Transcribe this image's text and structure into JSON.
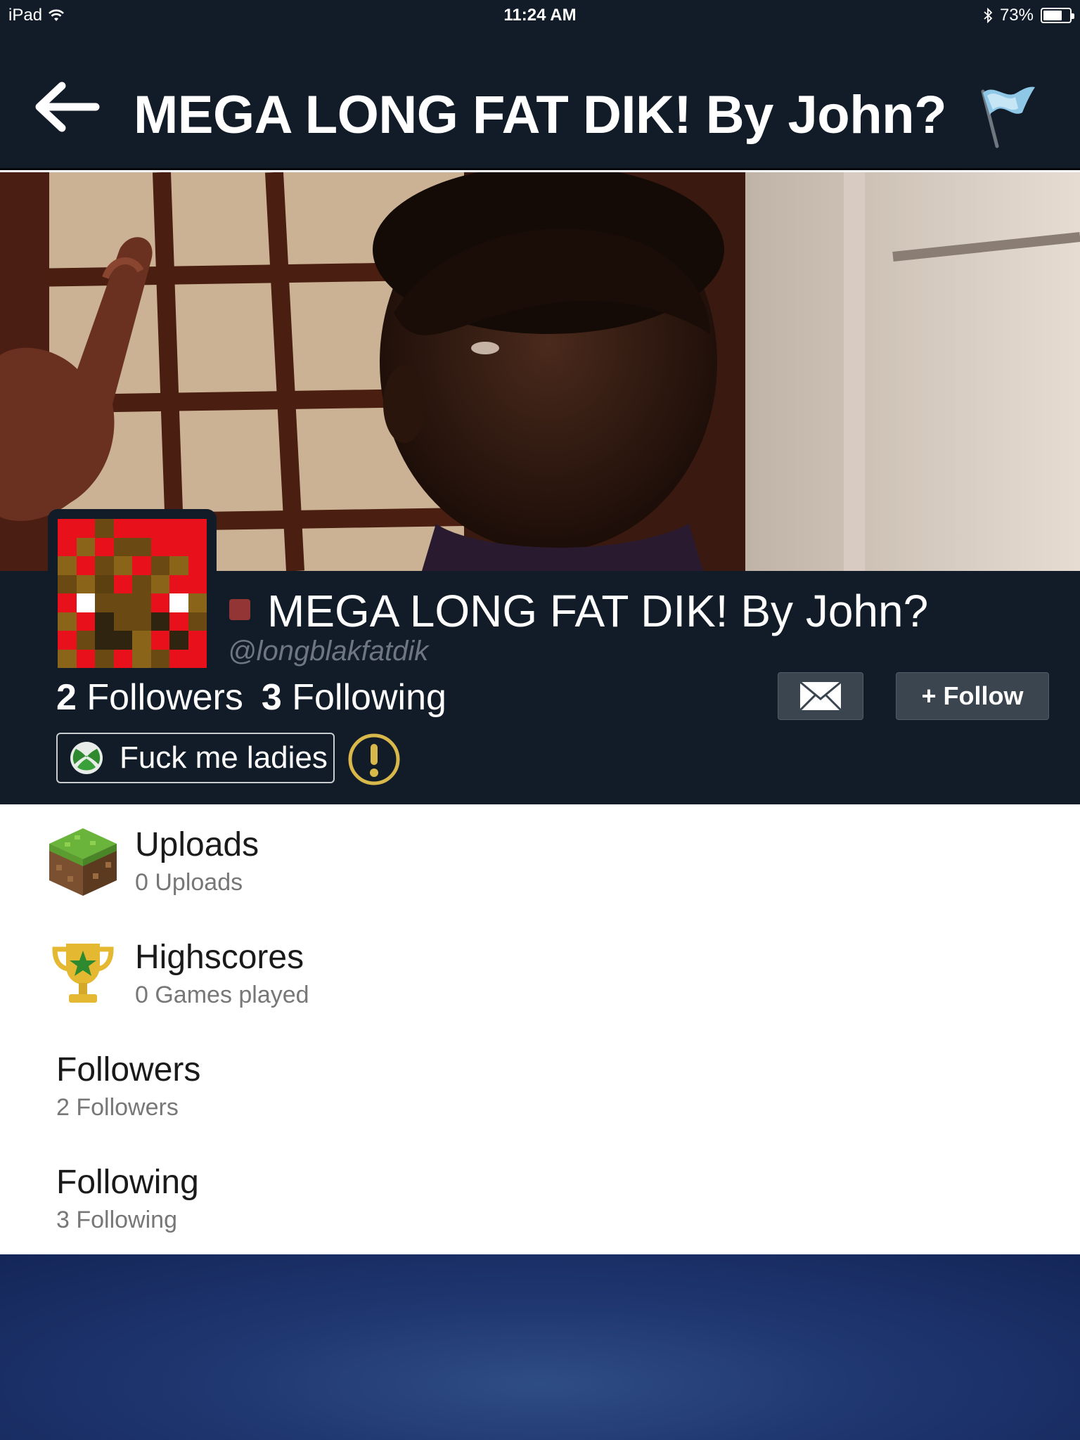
{
  "status_bar": {
    "device": "iPad",
    "time": "11:24 AM",
    "battery": "73%",
    "battery_level": 0.73
  },
  "nav": {
    "title": "MEGA LONG FAT DIK! By John?",
    "back_icon": "back-arrow-icon",
    "flag_icon": "flag-icon"
  },
  "profile": {
    "display_name": "MEGA LONG FAT DIK! By John?",
    "handle": "@longblakfatdik",
    "followers_count": "2",
    "followers_label": "Followers",
    "following_count": "3",
    "following_label": "Following",
    "follow_button": "+ Follow",
    "gamertag": "Fuck me ladies",
    "status_color": "#943535"
  },
  "list": {
    "uploads": {
      "title": "Uploads",
      "subtitle": "0 Uploads"
    },
    "highscores": {
      "title": "Highscores",
      "subtitle": "0 Games played"
    },
    "followers": {
      "title": "Followers",
      "subtitle": "2 Followers"
    },
    "following": {
      "title": "Following",
      "subtitle": "3 Following"
    }
  },
  "colors": {
    "header_bg": "#121c28",
    "button_bg": "#3b4550",
    "accent_gold": "#d8b84a"
  }
}
